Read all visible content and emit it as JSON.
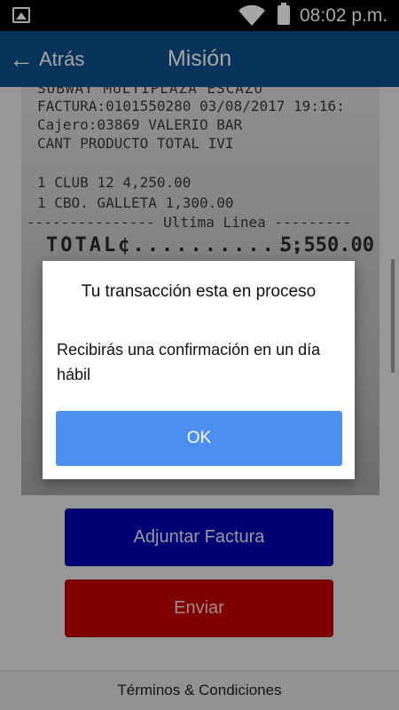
{
  "status_bar": {
    "time": "08:02 p.m."
  },
  "app_bar": {
    "back_label": "Atrás",
    "title": "Misión"
  },
  "receipt": {
    "store": "SUBWAY MULTIPLAZA ESCAZU",
    "invoice": "FACTURA:0101550280  03/08/2017 19:16:",
    "cashier": "Cajero:03869  VALERIO BAR",
    "header": "CANT   PRODUCTO              TOTAL IVI",
    "item1": "1 CLUB 12                  4,250.00",
    "item2": "1 CBO. GALLETA             1,300.00",
    "last_line": "--------------- Ultima Linea ---------",
    "total_label": "TOTAL¢...........:",
    "total_value": "5,550.00"
  },
  "buttons": {
    "attach": "Adjuntar Factura",
    "send": "Enviar"
  },
  "footer": {
    "terms": "Términos & Condiciones"
  },
  "dialog": {
    "title": "Tu transacción esta en proceso",
    "message": "Recibirás una confirmación en un día hábil",
    "ok_label": "OK"
  },
  "colors": {
    "app_bar": "#0d4f8c",
    "attach_button": "#0000b4",
    "send_button": "#c40000",
    "dialog_button": "#4b8ff3"
  }
}
